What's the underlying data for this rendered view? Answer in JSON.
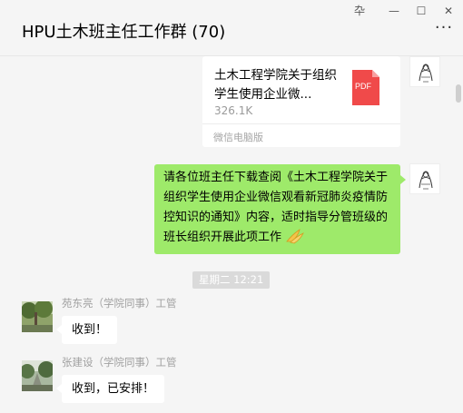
{
  "window": {
    "title": "HPU土木班主任工作群 (70)",
    "pin_glyph": "卆",
    "minimize_glyph": "—",
    "maximize_glyph": "☐",
    "close_glyph": "✕",
    "more_glyph": "···"
  },
  "messages": {
    "file": {
      "name": "土木工程学院关于组织学生使用企业微...",
      "size": "326.1K",
      "icon_label": "PDF",
      "source": "微信电脑版"
    },
    "notice": {
      "text": "请各位班主任下载查阅《土木工程学院关于组织学生使用企业微信观看新冠肺炎疫情防控知识的通知》内容，适时指导分管班级的班长组织开展此项工作"
    },
    "timestamp": "星期二 12:21",
    "reply1": {
      "sender": "苑东亮（学院同事）工管",
      "text": "收到！"
    },
    "reply2": {
      "sender": "张建设（学院同事）工管",
      "text": "收到，已安排！"
    }
  },
  "colors": {
    "self_bubble": "#9eea6a",
    "other_bubble": "#ffffff",
    "pdf_red": "#f04a4a"
  }
}
